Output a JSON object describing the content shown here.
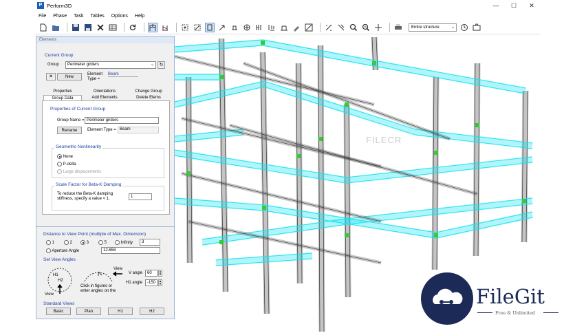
{
  "app": {
    "title": "Perform3D",
    "icon_letter": "P"
  },
  "window_controls": {
    "minimize": "—",
    "maximize": "☐",
    "close": "✕"
  },
  "menu": [
    "File",
    "Phase",
    "Task",
    "Tables",
    "Options",
    "Help"
  ],
  "toolbar": {
    "structure_select": "Entire structure",
    "icons": [
      "new-file-icon",
      "open-file-icon",
      "save-icon",
      "save-as-icon",
      "delete-icon",
      "table-icon",
      "refresh-icon",
      "frame-icon",
      "node-select-icon",
      "element-select-icon",
      "rectangle-select-icon",
      "pointer-icon",
      "support-icon",
      "load-icon",
      "mass-icon",
      "drift-icon",
      "deform-icon",
      "paint-icon",
      "wall-icon",
      "scale-icon",
      "zoom-window-icon",
      "zoom-in-icon",
      "zoom-out-icon",
      "print-icon",
      "help-icon",
      "camera-icon"
    ]
  },
  "panel": {
    "title": "Elements",
    "current_group": {
      "heading": "Current Group",
      "group_label": "Group",
      "group_value": "Perimeter girders",
      "new_button": "New",
      "element_type_label": "Element\nType =",
      "element_type_value": "Beam"
    },
    "tabs_row1": [
      "Properties",
      "Orientations",
      "Change Group"
    ],
    "tabs_row2": [
      "Group Data",
      "Add Elements",
      "Delete Elems"
    ],
    "properties": {
      "heading": "Properties of Current Group",
      "group_name_label": "Group Name =",
      "group_name_value": "Perimeter girders",
      "rename_button": "Rename",
      "element_type_label": "Element Type =",
      "element_type_value": "Beam"
    },
    "nonlinearity": {
      "heading": "Geometric Nonlinearity",
      "options": [
        "None",
        "P-delta",
        "Large displacements"
      ],
      "selected": "None"
    },
    "damping": {
      "heading": "Scale Factor for Beta-K Damping",
      "description": "To reduce the Beta-K damping\nstiffness, specify a value < 1.",
      "value": "1"
    },
    "view": {
      "distance_heading": "Distance to View Point (multiple of Max. Dimension)",
      "distance_options": [
        "1",
        "2",
        "3",
        "5",
        "Infinity"
      ],
      "distance_selected": "3",
      "infinity_value": "3",
      "aperture_label": "Aperture Angle",
      "aperture_value": "12.658",
      "angles_heading": "Set View Angles",
      "h1": "H1",
      "h2": "H2",
      "view_label": "View",
      "view_label2": "View",
      "click_hint": "Click in figures or\nenter angles on the",
      "v_angle_label": "V angle",
      "v_angle_value": "60",
      "h1_angle_label": "H1 angle",
      "h1_angle_value": "-150",
      "standard_heading": "Standard Views",
      "standard_buttons": [
        "Basic",
        "Plan",
        "H1",
        "H2"
      ]
    }
  },
  "watermark": {
    "brand": "FileGit",
    "tagline": "Free & Unlimited",
    "faint_text": "FILECR"
  },
  "colors": {
    "beam_cyan": "#19e3f0",
    "column_gray": "#555555",
    "node_green": "#33cc33",
    "brand_navy": "#1c2a57",
    "section_blue": "#1c3fa0"
  }
}
